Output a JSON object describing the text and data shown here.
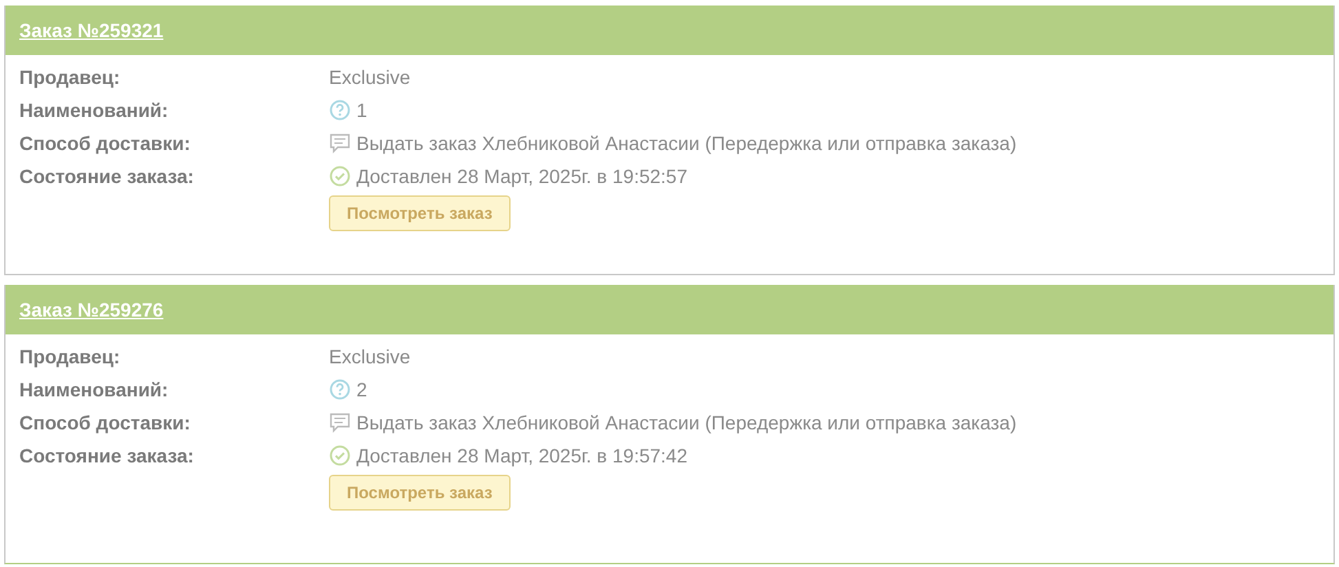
{
  "orders": [
    {
      "title": "Заказ №259321",
      "fields": [
        {
          "kind": "text",
          "label": "Продавец:",
          "value": "Exclusive"
        },
        {
          "kind": "count",
          "label": "Наименований:",
          "value": "1"
        },
        {
          "kind": "delivery",
          "label": "Способ доставки:",
          "value": "Выдать заказ Хлебниковой Анастасии (Передержка или отправка заказа)"
        },
        {
          "kind": "status",
          "label": "Состояние заказа:",
          "value": "Доставлен 28 Март, 2025г. в 19:52:57"
        }
      ],
      "button": "Посмотреть заказ"
    },
    {
      "title": "Заказ №259276",
      "fields": [
        {
          "kind": "text",
          "label": "Продавец:",
          "value": "Exclusive"
        },
        {
          "kind": "count",
          "label": "Наименований:",
          "value": "2"
        },
        {
          "kind": "delivery",
          "label": "Способ доставки:",
          "value": "Выдать заказ Хлебниковой Анастасии (Передержка или отправка заказа)"
        },
        {
          "kind": "status",
          "label": "Состояние заказа:",
          "value": "Доставлен 28 Март, 2025г. в 19:57:42"
        }
      ],
      "button": "Посмотреть заказ"
    }
  ]
}
